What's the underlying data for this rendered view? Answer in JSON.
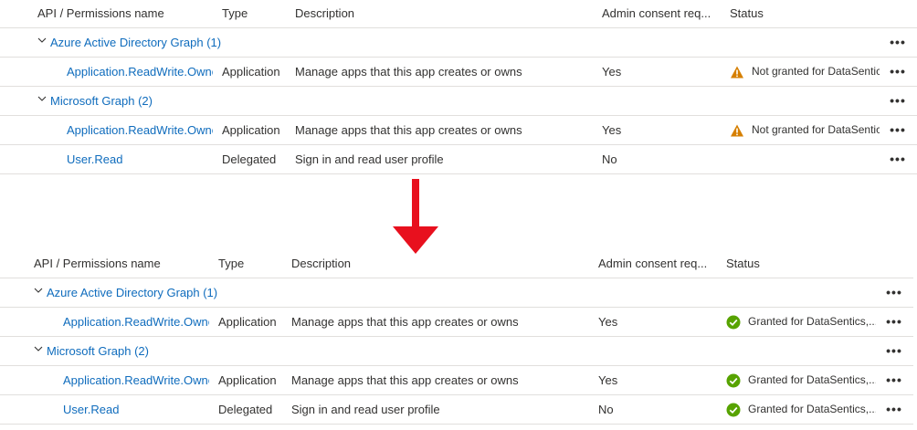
{
  "headers": {
    "name": "API / Permissions name",
    "type": "Type",
    "description": "Description",
    "admin": "Admin consent req...",
    "status": "Status"
  },
  "more_label": "•••",
  "before": {
    "groups": [
      {
        "name": "Azure Active Directory Graph (1)",
        "rows": [
          {
            "name": "Application.ReadWrite.OwnedBy",
            "type": "Application",
            "description": "Manage apps that this app creates or owns",
            "admin": "Yes",
            "status": "Not granted for DataSentics",
            "status_kind": "warning"
          }
        ]
      },
      {
        "name": "Microsoft Graph (2)",
        "rows": [
          {
            "name": "Application.ReadWrite.OwnedBy",
            "type": "Application",
            "description": "Manage apps that this app creates or owns",
            "admin": "Yes",
            "status": "Not granted for DataSentics",
            "status_kind": "warning"
          },
          {
            "name": "User.Read",
            "type": "Delegated",
            "description": "Sign in and read user profile",
            "admin": "No",
            "status": "",
            "status_kind": "none"
          }
        ]
      }
    ]
  },
  "after": {
    "groups": [
      {
        "name": "Azure Active Directory Graph (1)",
        "rows": [
          {
            "name": "Application.ReadWrite.OwnedBy",
            "type": "Application",
            "description": "Manage apps that this app creates or owns",
            "admin": "Yes",
            "status": "Granted for DataSentics,...",
            "status_kind": "success"
          }
        ]
      },
      {
        "name": "Microsoft Graph (2)",
        "rows": [
          {
            "name": "Application.ReadWrite.OwnedBy",
            "type": "Application",
            "description": "Manage apps that this app creates or owns",
            "admin": "Yes",
            "status": "Granted for DataSentics,...",
            "status_kind": "success"
          },
          {
            "name": "User.Read",
            "type": "Delegated",
            "description": "Sign in and read user profile",
            "admin": "No",
            "status": "Granted for DataSentics,...",
            "status_kind": "success"
          }
        ]
      }
    ]
  },
  "colors": {
    "link": "#0f6cbd",
    "warning": "#d67f00",
    "success": "#57a300",
    "arrow": "#e8101e"
  },
  "icons": {
    "group_toggle": "chevron-down-icon",
    "warning": "warning-icon",
    "success": "checkmark-circle-icon",
    "more": "more-actions-icon"
  }
}
